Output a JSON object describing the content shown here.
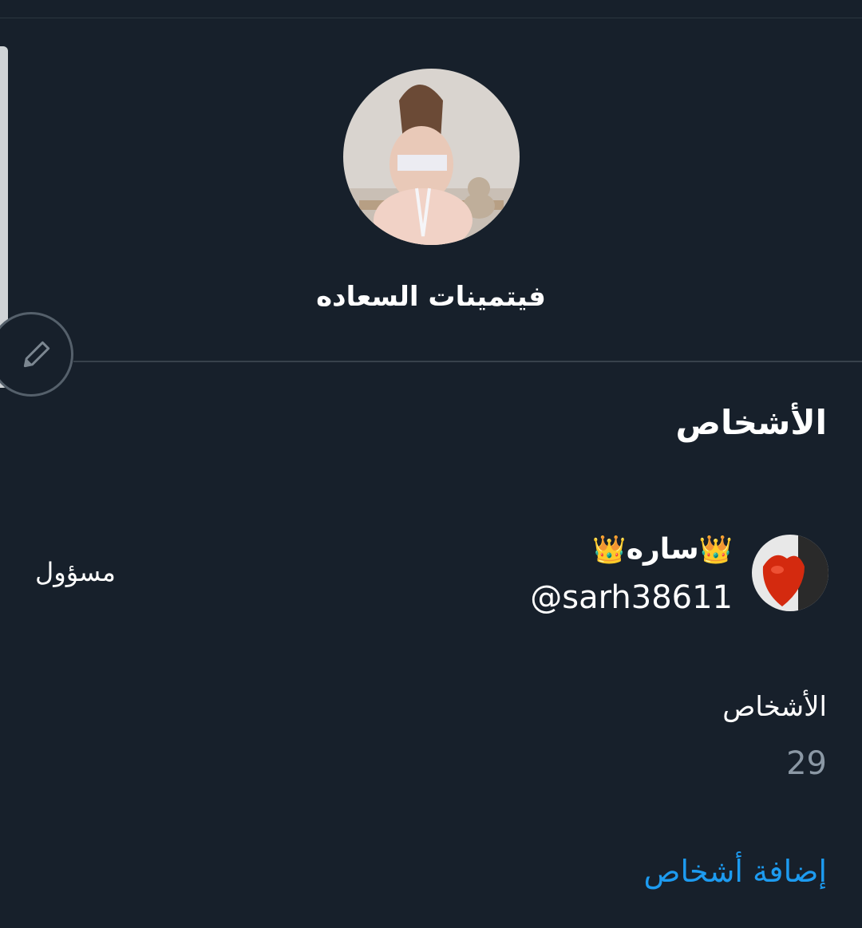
{
  "group": {
    "name": "فيتمينات السعاده"
  },
  "people_section": {
    "title": "الأشخاص"
  },
  "members": [
    {
      "name": "ساره",
      "name_prefix_emoji": "👑",
      "name_suffix_emoji": "👑",
      "handle": "@sarh38611",
      "role": "مسؤول"
    }
  ],
  "people_count": {
    "label": "الأشخاص",
    "value": "29"
  },
  "actions": {
    "add_people": "إضافة أشخاص"
  },
  "colors": {
    "background": "#17202b",
    "link": "#1d9bf0",
    "muted": "#8b98a5"
  },
  "icons": {
    "edit": "pencil-icon"
  }
}
